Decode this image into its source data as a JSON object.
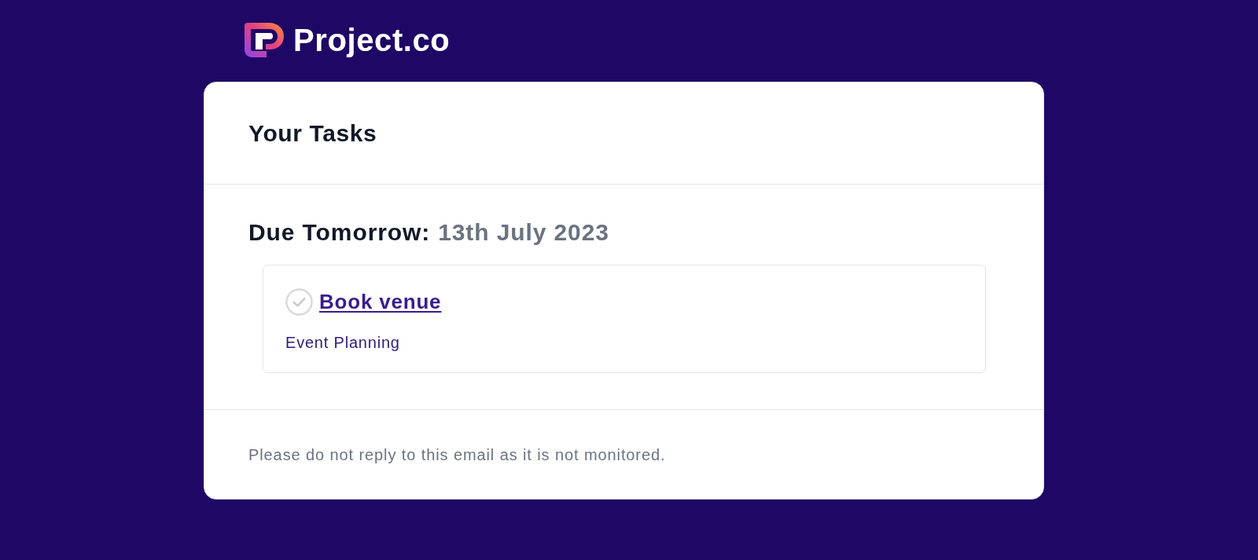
{
  "brand": {
    "name": "Project.co"
  },
  "card": {
    "title": "Your Tasks",
    "groups": [
      {
        "label": "Due Tomorrow:",
        "date": "13th July 2023",
        "tasks": [
          {
            "title": "Book venue",
            "project": "Event Planning",
            "completed": false
          }
        ]
      }
    ],
    "footer": "Please do not reply to this email as it is not monitored."
  }
}
